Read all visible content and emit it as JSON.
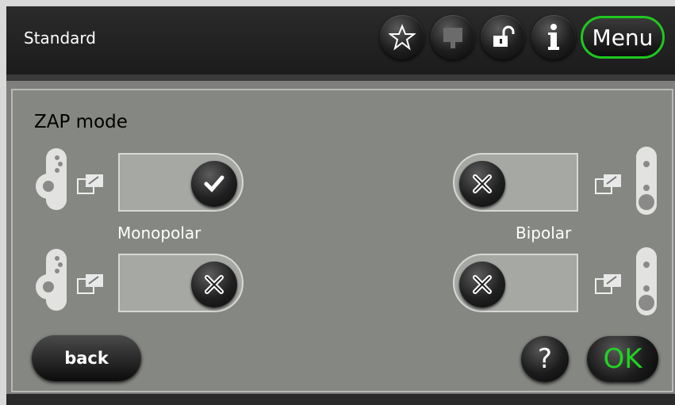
{
  "header": {
    "title": "Standard",
    "icons": [
      "star-icon",
      "monitor-icon",
      "unlock-icon",
      "info-icon"
    ],
    "menu_label": "Menu",
    "accent_color": "#1fc81f"
  },
  "main": {
    "section_title": "ZAP mode",
    "rows": [
      {
        "left": {
          "state": "checked",
          "label": "Monopolar"
        },
        "right": {
          "state": "unchecked",
          "label": "Bipolar"
        }
      },
      {
        "left": {
          "state": "unchecked",
          "label": ""
        },
        "right": {
          "state": "unchecked",
          "label": ""
        }
      }
    ]
  },
  "footer": {
    "back_label": "back",
    "help_label": "?",
    "ok_label": "OK",
    "ok_color": "#22d322"
  }
}
